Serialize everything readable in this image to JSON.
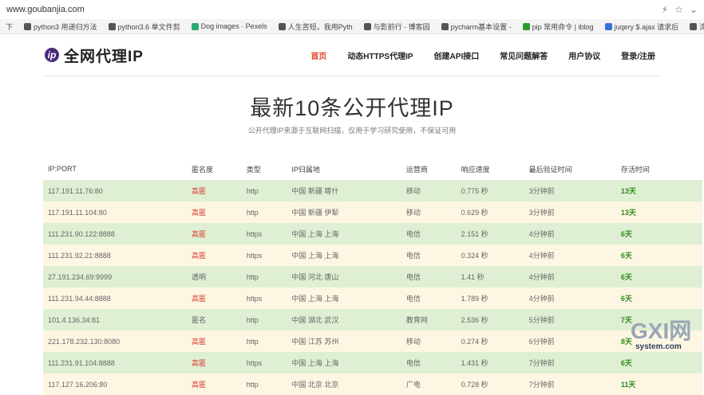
{
  "browser": {
    "url": "www.goubanjia.com",
    "bookmarks": [
      {
        "label": "下",
        "color": "#777"
      },
      {
        "label": "python3 用递归方法",
        "color": "#555"
      },
      {
        "label": "python3.6 单文件剪",
        "color": "#555"
      },
      {
        "label": "Dog images · Pexels",
        "color": "#2aa876"
      },
      {
        "label": "人生苦短，我用Pyth",
        "color": "#555"
      },
      {
        "label": "与影前行 - 博客园",
        "color": "#555"
      },
      {
        "label": "pycharm基本设置 -",
        "color": "#555"
      },
      {
        "label": "pip 常用命令 | iblog",
        "color": "#2c9a2c"
      },
      {
        "label": "juqery $.ajax 请求后",
        "color": "#3a6fd8"
      },
      {
        "label": "流星飞雨v - 博客",
        "color": "#555"
      }
    ]
  },
  "header": {
    "logo_mark": "ip",
    "logo_text": "全网代理IP",
    "nav": [
      "首页",
      "动态HTTPS代理IP",
      "创建API接口",
      "常见问题解答",
      "用户协议",
      "登录/注册"
    ]
  },
  "main": {
    "title": "最新10条公开代理IP",
    "subtitle": "公开代理IP来源于互联网扫描，仅用于学习研究使用，不保证可用"
  },
  "table": {
    "headers": [
      "IP:PORT",
      "匿名度",
      "类型",
      "IP归属地",
      "运营商",
      "响应速度",
      "最后验证时间",
      "存活时间"
    ],
    "rows": [
      {
        "ip": "117.191.11.76:80",
        "anon": "高匿",
        "type": "http",
        "loc": "中国  新疆  喀什",
        "isp": "移动",
        "speed": "0.775 秒",
        "verified": "3分钟前",
        "alive": "13天"
      },
      {
        "ip": "117.191.11.104:80",
        "anon": "高匿",
        "type": "http",
        "loc": "中国  新疆  伊犁",
        "isp": "移动",
        "speed": "0.629 秒",
        "verified": "3分钟前",
        "alive": "13天"
      },
      {
        "ip": "111.231.90.122:8888",
        "anon": "高匿",
        "type": "https",
        "loc": "中国  上海  上海",
        "isp": "电信",
        "speed": "2.151 秒",
        "verified": "4分钟前",
        "alive": "6天"
      },
      {
        "ip": "111.231.92.21:8888",
        "anon": "高匿",
        "type": "https",
        "loc": "中国  上海  上海",
        "isp": "电信",
        "speed": "0.324 秒",
        "verified": "4分钟前",
        "alive": "6天"
      },
      {
        "ip": "27.191.234.69:9999",
        "anon": "透明",
        "type": "http",
        "loc": "中国  河北  唐山",
        "isp": "电信",
        "speed": "1.41 秒",
        "verified": "4分钟前",
        "alive": "6天"
      },
      {
        "ip": "111.231.94.44:8888",
        "anon": "高匿",
        "type": "https",
        "loc": "中国  上海  上海",
        "isp": "电信",
        "speed": "1.789 秒",
        "verified": "4分钟前",
        "alive": "6天"
      },
      {
        "ip": "101.4.136.34:81",
        "anon": "匿名",
        "type": "http",
        "loc": "中国  湖北  武汉",
        "isp": "教育网",
        "speed": "2.536 秒",
        "verified": "5分钟前",
        "alive": "7天"
      },
      {
        "ip": "221.178.232.130:8080",
        "anon": "高匿",
        "type": "http",
        "loc": "中国  江苏  苏州",
        "isp": "移动",
        "speed": "0.274 秒",
        "verified": "6分钟前",
        "alive": "8天"
      },
      {
        "ip": "111.231.91.104:8888",
        "anon": "高匿",
        "type": "https",
        "loc": "中国  上海  上海",
        "isp": "电信",
        "speed": "1.431 秒",
        "verified": "7分钟前",
        "alive": "6天"
      },
      {
        "ip": "117.127.16.206:80",
        "anon": "高匿",
        "type": "http",
        "loc": "中国  北京  北京",
        "isp": "广电",
        "speed": "0.728 秒",
        "verified": "7分钟前",
        "alive": "11天"
      }
    ]
  },
  "watermark": {
    "brand": "GXI网",
    "domain": "system.com"
  }
}
